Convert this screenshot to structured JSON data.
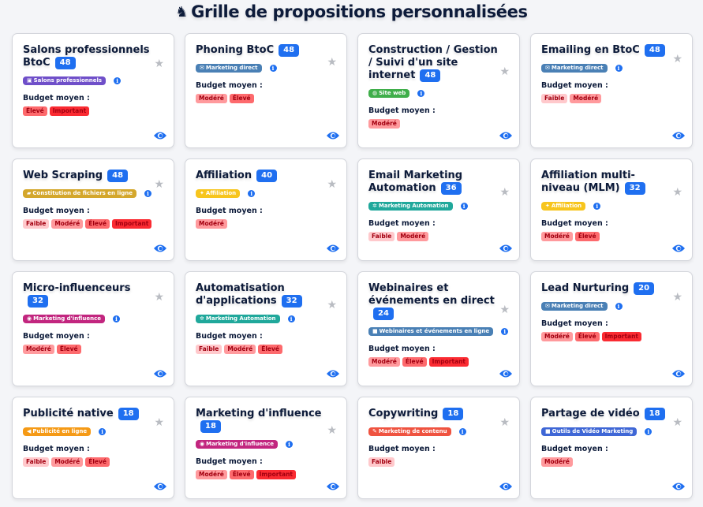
{
  "header": {
    "title_icon": "chess-knight-icon",
    "title": "Grille de propositions personnalisées"
  },
  "budget_label": "Budget moyen :",
  "budget_colors": {
    "Faible": "#ffc9cc",
    "Modéré": "#ff9a9d",
    "Élevé": "#fd6a6d",
    "Important": "#fa2b32"
  },
  "cards": [
    {
      "title": "Salons professionnels BtoC",
      "count": "48",
      "category": "Salons professionnels",
      "category_icon": "briefcase-icon",
      "category_color": "#6f4fc9",
      "budget": [
        "Élevé",
        "Important"
      ]
    },
    {
      "title": "Phoning BtoC",
      "count": "48",
      "category": "Marketing direct",
      "category_icon": "envelope-icon",
      "category_color": "#4a80b5",
      "budget": [
        "Modéré",
        "Élevé"
      ]
    },
    {
      "title": "Construction / Gestion / Suivi d'un site internet",
      "count": "48",
      "category": "Site web",
      "category_icon": "globe-icon",
      "category_color": "#3fae4a",
      "budget": [
        "Modéré"
      ]
    },
    {
      "title": "Emailing en BtoC",
      "count": "48",
      "category": "Marketing direct",
      "category_icon": "envelope-icon",
      "category_color": "#4a80b5",
      "budget": [
        "Faible",
        "Modéré"
      ]
    },
    {
      "title": "Web Scraping",
      "count": "48",
      "category": "Constitution de fichiers en ligne",
      "category_icon": "folder-icon",
      "category_color": "#d4a72c",
      "budget": [
        "Faible",
        "Modéré",
        "Élevé",
        "Important"
      ]
    },
    {
      "title": "Affiliation",
      "count": "40",
      "category": "Affiliation",
      "category_icon": "handshake-icon",
      "category_color": "#f7c51d",
      "budget": [
        "Modéré"
      ]
    },
    {
      "title": "Email Marketing Automation",
      "count": "36",
      "category": "Marketing Automation",
      "category_icon": "gears-icon",
      "category_color": "#20a89b",
      "budget": [
        "Faible",
        "Modéré"
      ]
    },
    {
      "title": "Affiliation multi-niveau (MLM)",
      "count": "32",
      "category": "Affiliation",
      "category_icon": "handshake-icon",
      "category_color": "#f7c51d",
      "budget": [
        "Modéré",
        "Élevé"
      ]
    },
    {
      "title": "Micro-influenceurs",
      "count": "32",
      "category": "Marketing d'influence",
      "category_icon": "users-icon",
      "category_color": "#c2267f",
      "budget": [
        "Modéré",
        "Élevé"
      ]
    },
    {
      "title": "Automatisation d'applications",
      "count": "32",
      "category": "Marketing Automation",
      "category_icon": "gears-icon",
      "category_color": "#20a89b",
      "budget": [
        "Faible",
        "Modéré",
        "Élevé"
      ]
    },
    {
      "title": "Webinaires et événements en direct",
      "count": "24",
      "category": "Webinaires et événements en ligne",
      "category_icon": "video-icon",
      "category_color": "#4a80b5",
      "budget": [
        "Modéré",
        "Élevé",
        "Important"
      ]
    },
    {
      "title": "Lead Nurturing",
      "count": "20",
      "category": "Marketing direct",
      "category_icon": "envelope-icon",
      "category_color": "#4a80b5",
      "budget": [
        "Modéré",
        "Élevé",
        "Important"
      ]
    },
    {
      "title": "Publicité native",
      "count": "18",
      "category": "Publicité en ligne",
      "category_icon": "bullhorn-icon",
      "category_color": "#f59a16",
      "budget": [
        "Faible",
        "Modéré",
        "Élevé"
      ]
    },
    {
      "title": "Marketing d'influence",
      "count": "18",
      "category": "Marketing d'influence",
      "category_icon": "users-icon",
      "category_color": "#c2267f",
      "budget": [
        "Modéré",
        "Élevé",
        "Important"
      ]
    },
    {
      "title": "Copywriting",
      "count": "18",
      "category": "Marketing de contenu",
      "category_icon": "pencil-icon",
      "category_color": "#ef5340",
      "budget": [
        "Faible"
      ]
    },
    {
      "title": "Partage de vidéo",
      "count": "18",
      "category": "Outils de Vidéo Marketing",
      "category_icon": "video-icon",
      "category_color": "#3f67d6",
      "budget": [
        "Modéré"
      ]
    }
  ]
}
